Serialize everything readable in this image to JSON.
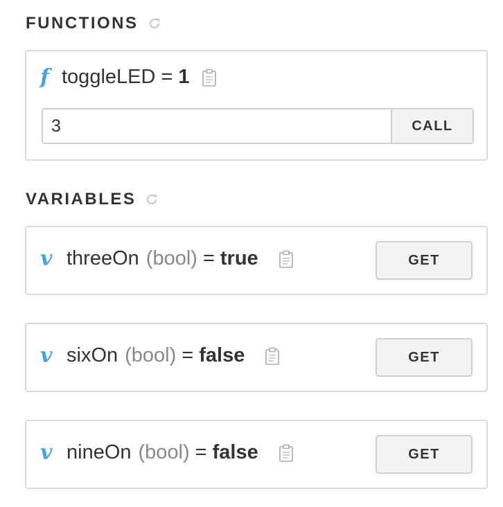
{
  "functions": {
    "header": "FUNCTIONS",
    "items": [
      {
        "glyph": "f",
        "name": "toggleLED",
        "equals": "=",
        "value": "1",
        "arg_value": "3",
        "call_label": "CALL"
      }
    ]
  },
  "variables": {
    "header": "VARIABLES",
    "items": [
      {
        "glyph": "v",
        "name": "threeOn",
        "type": "(bool)",
        "equals": "=",
        "value": "true",
        "get_label": "GET"
      },
      {
        "glyph": "v",
        "name": "sixOn",
        "type": "(bool)",
        "equals": "=",
        "value": "false",
        "get_label": "GET"
      },
      {
        "glyph": "v",
        "name": "nineOn",
        "type": "(bool)",
        "equals": "=",
        "value": "false",
        "get_label": "GET"
      }
    ]
  },
  "colors": {
    "accent": "#4aa3df",
    "border": "#d9d9d9",
    "button_bg": "#f3f3f3",
    "text": "#333333",
    "muted": "#888888"
  },
  "icons": {
    "refresh": "refresh-icon",
    "copy": "clipboard-icon"
  }
}
